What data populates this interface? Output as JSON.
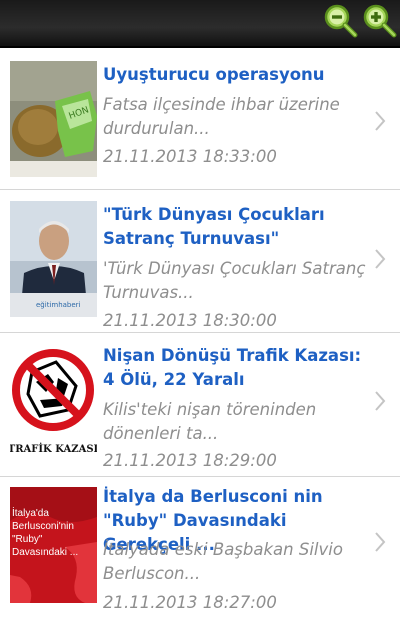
{
  "toolbar": {
    "zoom_out_icon": "zoom-out-magnifier-icon",
    "zoom_in_icon": "zoom-in-magnifier-icon",
    "icon_color": "#8cc63f"
  },
  "news": [
    {
      "title": "Uyuşturucu operasyonu",
      "summary": "Fatsa ilçesinde ihbar üzerine durdurulan...",
      "date": "21.11.2013 18:33:00",
      "thumb": "drug-bag-photo"
    },
    {
      "title": "\"Türk Dünyası Çocukları Satranç Turnuvası\"",
      "summary": "'Türk Dünyası Çocukları Satranç Turnuvas...",
      "date": "21.11.2013 18:30:00",
      "thumb": "speaker-photo",
      "thumb_text": "eğitimhaberi"
    },
    {
      "title": "Nişan Dönüşü Trafik Kazası: 4 Ölü, 22 Yaralı",
      "summary": "Kilis'teki nişan töreninden dönenleri ta...",
      "date": "21.11.2013 18:29:00",
      "thumb": "traffic-accident-sign",
      "thumb_text": "TRAFİK KAZASI"
    },
    {
      "title": "İtalya da Berlusconi nin \"Ruby\" Davasındaki Gerekçeli ...",
      "summary": "İtalyada eski Başbakan Silvio Berluscon...",
      "date": "21.11.2013 18:27:00",
      "thumb": "red-map-graphic",
      "thumb_text": "İtalya'da Berlusconi'nin \"Ruby\" Davasındaki ..."
    }
  ]
}
